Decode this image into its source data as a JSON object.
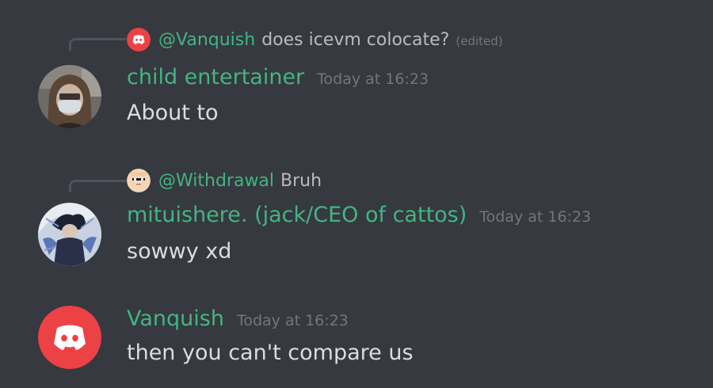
{
  "messages": [
    {
      "reply": {
        "author": "@Vanquish",
        "text": "does icevm colocate?",
        "edited": "(edited)",
        "avatar_icon": "discord-logo-icon"
      },
      "author": "child entertainer",
      "timestamp": "Today at 16:23",
      "content": "About to",
      "avatar_icon": "user-photo-avatar"
    },
    {
      "reply": {
        "author": "@Withdrawal",
        "text": "Bruh",
        "avatar_icon": "pixel-face-avatar"
      },
      "author": "mituishere. (jack/CEO of cattos)",
      "timestamp": "Today at 16:23",
      "content": "sowwy xd",
      "avatar_icon": "anime-character-avatar"
    },
    {
      "author": "Vanquish",
      "timestamp": "Today at 16:23",
      "content": "then you can't compare us",
      "avatar_icon": "discord-logo-icon"
    }
  ],
  "colors": {
    "background": "#36393f",
    "username": "#43b581",
    "text": "#dcddde",
    "muted": "#72767d",
    "discord_red": "#ed4245"
  }
}
